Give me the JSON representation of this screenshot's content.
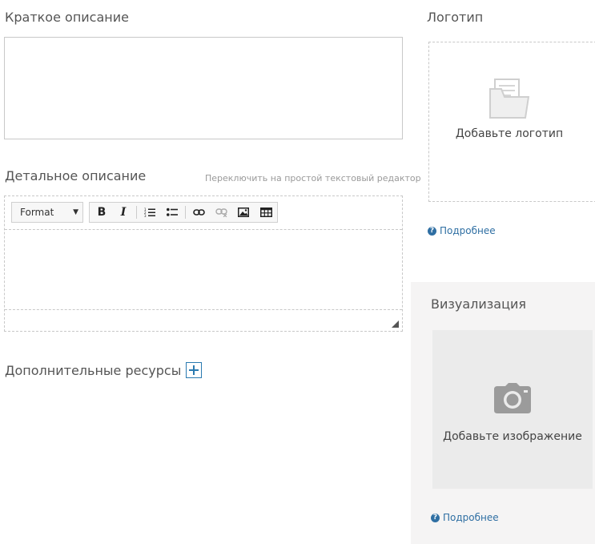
{
  "short_description": {
    "label": "Краткое описание",
    "value": ""
  },
  "detailed_description": {
    "label": "Детальное описание",
    "switch_editor_link": "Переключить на простой текстовый редактор",
    "toolbar": {
      "format_select": "Format",
      "buttons": [
        "bold-icon",
        "italic-icon",
        "ordered-list-icon",
        "bullet-list-icon",
        "link-icon",
        "unlink-icon",
        "image-icon",
        "table-icon"
      ],
      "bold_glyph": "B",
      "italic_glyph": "I"
    },
    "body": ""
  },
  "additional_resources": {
    "label": "Дополнительные ресурсы"
  },
  "logo": {
    "label": "Логотип",
    "dropzone_text": "Добавьте логотип",
    "more_link": "Подробнее"
  },
  "visualization": {
    "label": "Визуализация",
    "dropzone_text": "Добавьте изображение",
    "more_link": "Подробнее"
  },
  "colors": {
    "link": "#2f6fa3",
    "accent_border": "#2a7ab0",
    "panel_bg": "#f5f4f4"
  }
}
